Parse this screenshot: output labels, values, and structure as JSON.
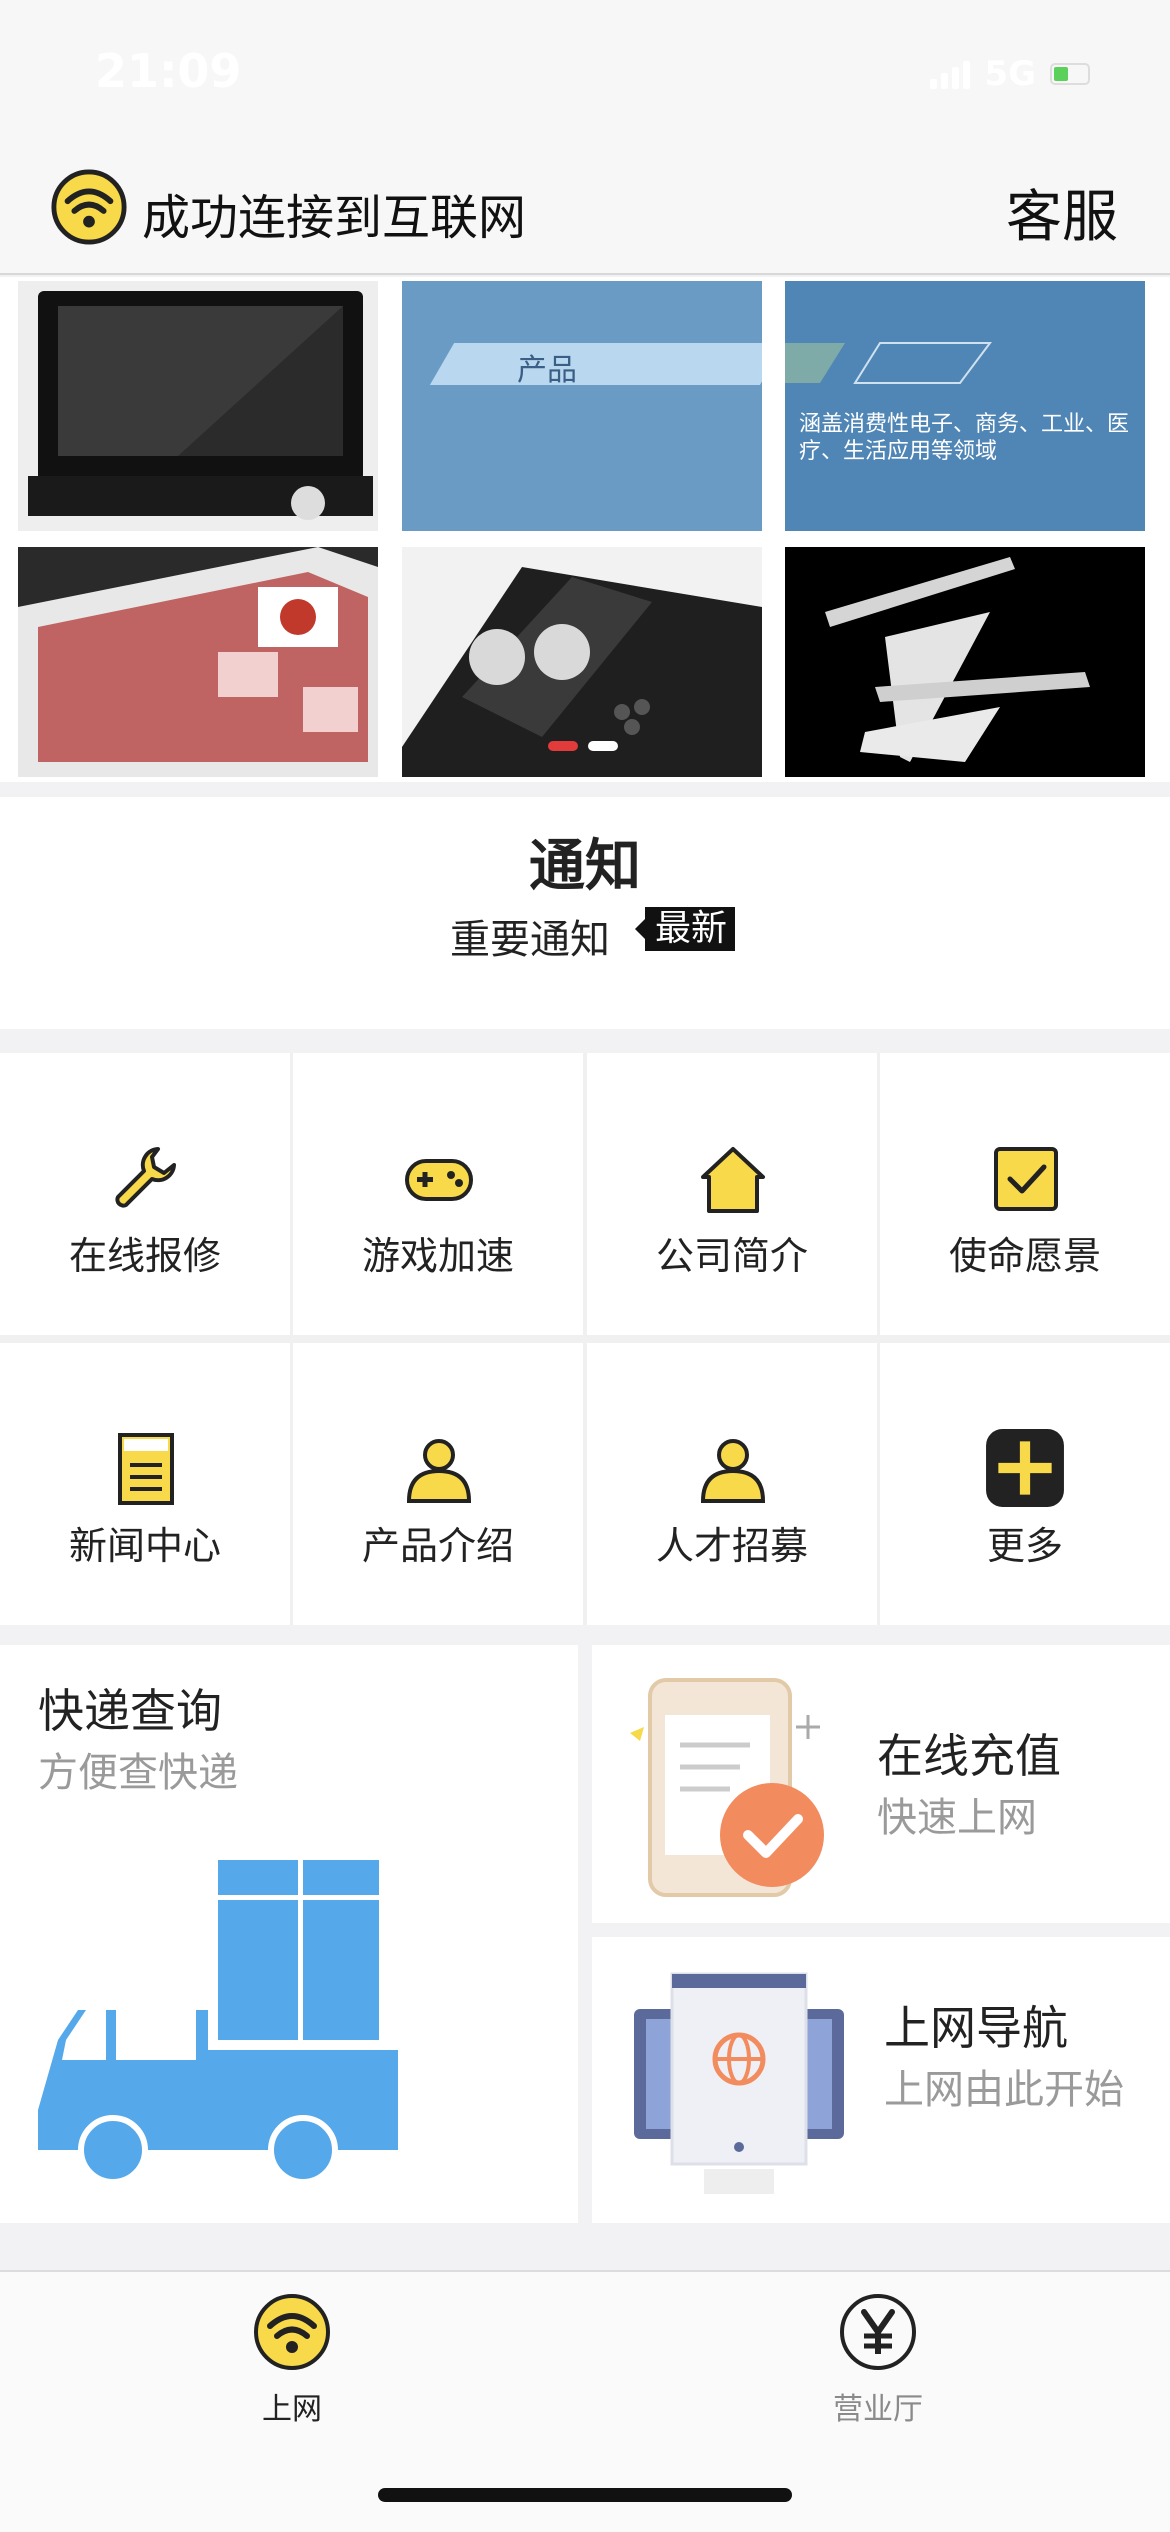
{
  "status_bar": {
    "time": "21:09",
    "network": "5G"
  },
  "header": {
    "title": "成功连接到互联网",
    "service": "客服"
  },
  "banner": {
    "product_tag": "产品",
    "product_desc": "涵盖消费性电子、商务、工业、医疗、生活应用等领域",
    "active_dot_color": "#e23b3b"
  },
  "notice": {
    "title": "通知",
    "subtitle": "重要通知",
    "badge": "最新"
  },
  "grid": {
    "items": [
      {
        "label": "在线报修",
        "icon": "wrench-icon"
      },
      {
        "label": "游戏加速",
        "icon": "gamepad-icon"
      },
      {
        "label": "公司简介",
        "icon": "house-icon"
      },
      {
        "label": "使命愿景",
        "icon": "checkbox-icon"
      },
      {
        "label": "新闻中心",
        "icon": "news-icon"
      },
      {
        "label": "产品介绍",
        "icon": "person-icon"
      },
      {
        "label": "人才招募",
        "icon": "person-icon"
      },
      {
        "label": "更多",
        "icon": "plus-icon"
      }
    ]
  },
  "cards": {
    "express": {
      "title": "快递查询",
      "subtitle": "方便查快递"
    },
    "recharge": {
      "title": "在线充值",
      "subtitle": "快速上网"
    },
    "nav": {
      "title": "上网导航",
      "subtitle": "上网由此开始"
    }
  },
  "tabbar": {
    "items": [
      {
        "label": "上网",
        "active": true
      },
      {
        "label": "营业厅",
        "active": false
      }
    ]
  },
  "colors": {
    "accent_yellow": "#f8d949",
    "express_blue": "#55a8ea",
    "recharge_orange": "#f28b5d"
  }
}
